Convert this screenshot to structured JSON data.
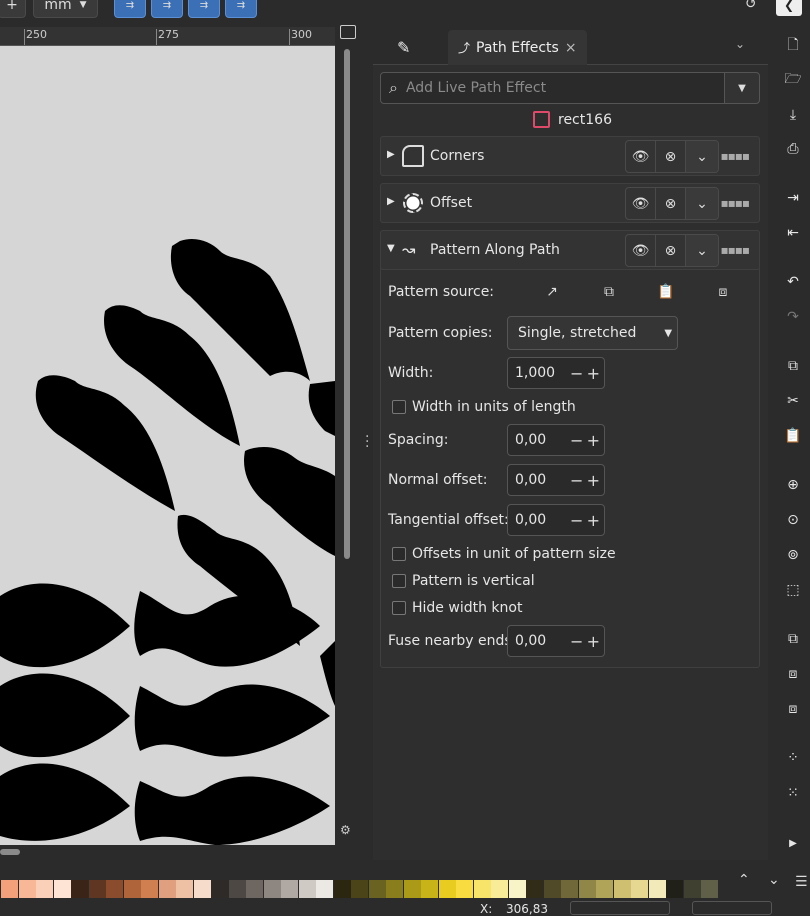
{
  "toolbar": {
    "unit": "mm"
  },
  "ruler": {
    "ticks": [
      "250",
      "275",
      "300"
    ]
  },
  "panel": {
    "tabs": [
      {
        "label": "",
        "icon": "fill-stroke-icon"
      },
      {
        "label": "Path Effects",
        "icon": "path-effects-icon",
        "close": "×"
      }
    ],
    "search_placeholder": "Add Live Path Effect",
    "object_name": "rect166",
    "object_color": "#e04a6a",
    "effects": [
      {
        "name": "Corners",
        "expanded": false
      },
      {
        "name": "Offset",
        "expanded": false
      },
      {
        "name": "Pattern Along Path",
        "expanded": true
      }
    ],
    "params": {
      "pattern_source_label": "Pattern source:",
      "pattern_copies_label": "Pattern copies:",
      "pattern_copies_value": "Single, stretched",
      "width_label": "Width:",
      "width_value": "1,000",
      "width_units_label": "Width in units of length",
      "spacing_label": "Spacing:",
      "spacing_value": "0,00",
      "normal_offset_label": "Normal offset:",
      "normal_offset_value": "0,00",
      "tangential_offset_label": "Tangential offset:",
      "tangential_offset_value": "0,00",
      "offsets_unit_label": "Offsets in unit of pattern size",
      "vertical_label": "Pattern is vertical",
      "hide_knot_label": "Hide width knot",
      "fuse_label": "Fuse nearby ends:",
      "fuse_value": "0,00"
    }
  },
  "status": {
    "x_label": "X:",
    "x_value": "306,83"
  },
  "palette": [
    "#f4a07a",
    "#f8b898",
    "#fbd0b8",
    "#fde4d4",
    "#3a2418",
    "#5e3622",
    "#8a4c2c",
    "#b0643a",
    "#d08050",
    "#e0a080",
    "#eec0a4",
    "#f6dccb",
    "#2e2a28",
    "#4e4844",
    "#6e6660",
    "#8e8680",
    "#b0a8a2",
    "#d0cac4",
    "#ece8e4",
    "#2a2610",
    "#4a4418",
    "#6a6220",
    "#8a7e1c",
    "#aa9a18",
    "#c8b418",
    "#e8cc20",
    "#f8dc40",
    "#f8e468",
    "#f8ec98",
    "#f8f4c8",
    "#302c18",
    "#504a28",
    "#706838",
    "#908648",
    "#b0a458",
    "#cec070",
    "#e6d890",
    "#f2eab8",
    "#202018",
    "#404030",
    "#606048"
  ]
}
